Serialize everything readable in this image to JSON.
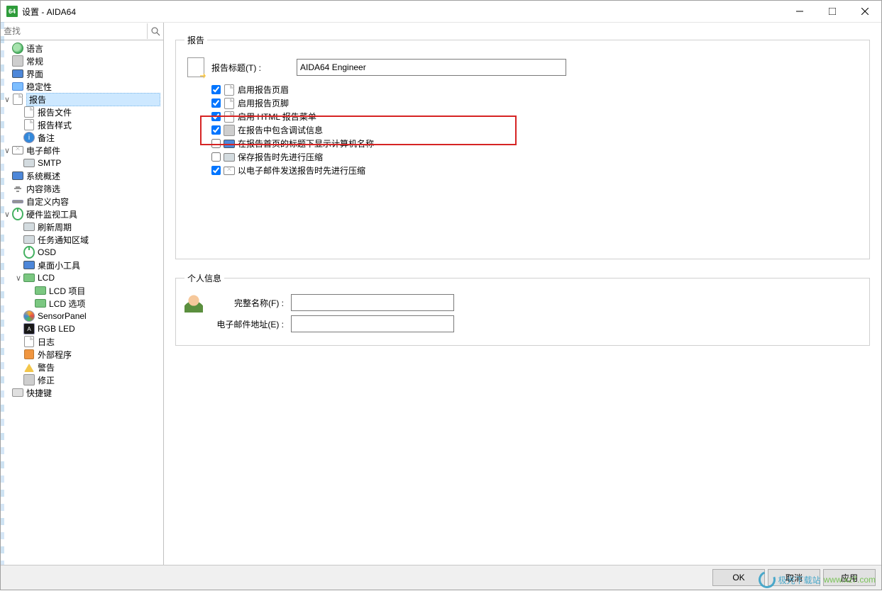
{
  "window": {
    "title": "设置 - AIDA64",
    "app_icon_text": "64"
  },
  "search": {
    "placeholder": "查找"
  },
  "tree": [
    {
      "label": "语言",
      "icon": "ic-globe",
      "depth": 0,
      "exp": ""
    },
    {
      "label": "常规",
      "icon": "ic-gear",
      "depth": 0,
      "exp": ""
    },
    {
      "label": "界面",
      "icon": "ic-mon",
      "depth": 0,
      "exp": ""
    },
    {
      "label": "稳定性",
      "icon": "ic-net",
      "depth": 0,
      "exp": ""
    },
    {
      "label": "报告",
      "icon": "ic-doc",
      "depth": 0,
      "exp": "∨",
      "selected": true
    },
    {
      "label": "报告文件",
      "icon": "ic-doc",
      "depth": 1,
      "exp": ""
    },
    {
      "label": "报告样式",
      "icon": "ic-doc",
      "depth": 1,
      "exp": ""
    },
    {
      "label": "备注",
      "icon": "ic-info",
      "depth": 1,
      "exp": "",
      "iconText": "i"
    },
    {
      "label": "电子邮件",
      "icon": "ic-mail",
      "depth": 0,
      "exp": "∨"
    },
    {
      "label": "SMTP",
      "icon": "ic-disk",
      "depth": 1,
      "exp": ""
    },
    {
      "label": "系统概述",
      "icon": "ic-mon",
      "depth": 0,
      "exp": ""
    },
    {
      "label": "内容筛选",
      "icon": "ic-filter",
      "depth": 0,
      "exp": ""
    },
    {
      "label": "自定义内容",
      "icon": "ic-bar",
      "depth": 0,
      "exp": ""
    },
    {
      "label": "硬件监视工具",
      "icon": "ic-circle",
      "depth": 0,
      "exp": "∨"
    },
    {
      "label": "刷新周期",
      "icon": "ic-disk",
      "depth": 1,
      "exp": ""
    },
    {
      "label": "任务通知区域",
      "icon": "ic-disk",
      "depth": 1,
      "exp": ""
    },
    {
      "label": "OSD",
      "icon": "ic-circle",
      "depth": 1,
      "exp": ""
    },
    {
      "label": "桌面小工具",
      "icon": "ic-mon",
      "depth": 1,
      "exp": ""
    },
    {
      "label": "LCD",
      "icon": "ic-lcd",
      "depth": 1,
      "exp": "∨"
    },
    {
      "label": "LCD 项目",
      "icon": "ic-lcd",
      "depth": 2,
      "exp": ""
    },
    {
      "label": "LCD 选项",
      "icon": "ic-lcd",
      "depth": 2,
      "exp": ""
    },
    {
      "label": "SensorPanel",
      "icon": "ic-sensor",
      "depth": 1,
      "exp": ""
    },
    {
      "label": "RGB LED",
      "icon": "ic-rgb",
      "depth": 1,
      "exp": "",
      "iconText": "A"
    },
    {
      "label": "日志",
      "icon": "ic-doc",
      "depth": 1,
      "exp": ""
    },
    {
      "label": "外部程序",
      "icon": "ic-ext",
      "depth": 1,
      "exp": ""
    },
    {
      "label": "警告",
      "icon": "ic-warn",
      "depth": 1,
      "exp": ""
    },
    {
      "label": "修正",
      "icon": "ic-gear",
      "depth": 1,
      "exp": ""
    },
    {
      "label": "快捷键",
      "icon": "ic-key",
      "depth": 0,
      "exp": ""
    }
  ],
  "report": {
    "group_title": "报告",
    "title_label": "报告标题(T) :",
    "title_value": "AIDA64 Engineer",
    "checks": [
      {
        "label": "启用报告页眉",
        "checked": true,
        "icon": "ic-doc"
      },
      {
        "label": "启用报告页脚",
        "checked": true,
        "icon": "ic-doc"
      },
      {
        "label": "启用 HTML 报告菜单",
        "checked": true,
        "icon": "ic-doc"
      },
      {
        "label": "在报告中包含调试信息",
        "checked": true,
        "icon": "ic-gear"
      },
      {
        "label": "在报告首页的标题下显示计算机名称",
        "checked": false,
        "icon": "ic-mon"
      },
      {
        "label": "保存报告时先进行压缩",
        "checked": false,
        "icon": "ic-disk"
      },
      {
        "label": "以电子邮件发送报告时先进行压缩",
        "checked": true,
        "icon": "ic-mail"
      }
    ]
  },
  "personal": {
    "group_title": "个人信息",
    "name_label": "完整名称(F) :",
    "name_value": "",
    "email_label": "电子邮件地址(E) :",
    "email_value": ""
  },
  "buttons": {
    "ok": "OK",
    "cancel": "取消",
    "apply": "应用"
  },
  "watermark": {
    "site": "极光下载站",
    "url": "www.xz7.com"
  }
}
